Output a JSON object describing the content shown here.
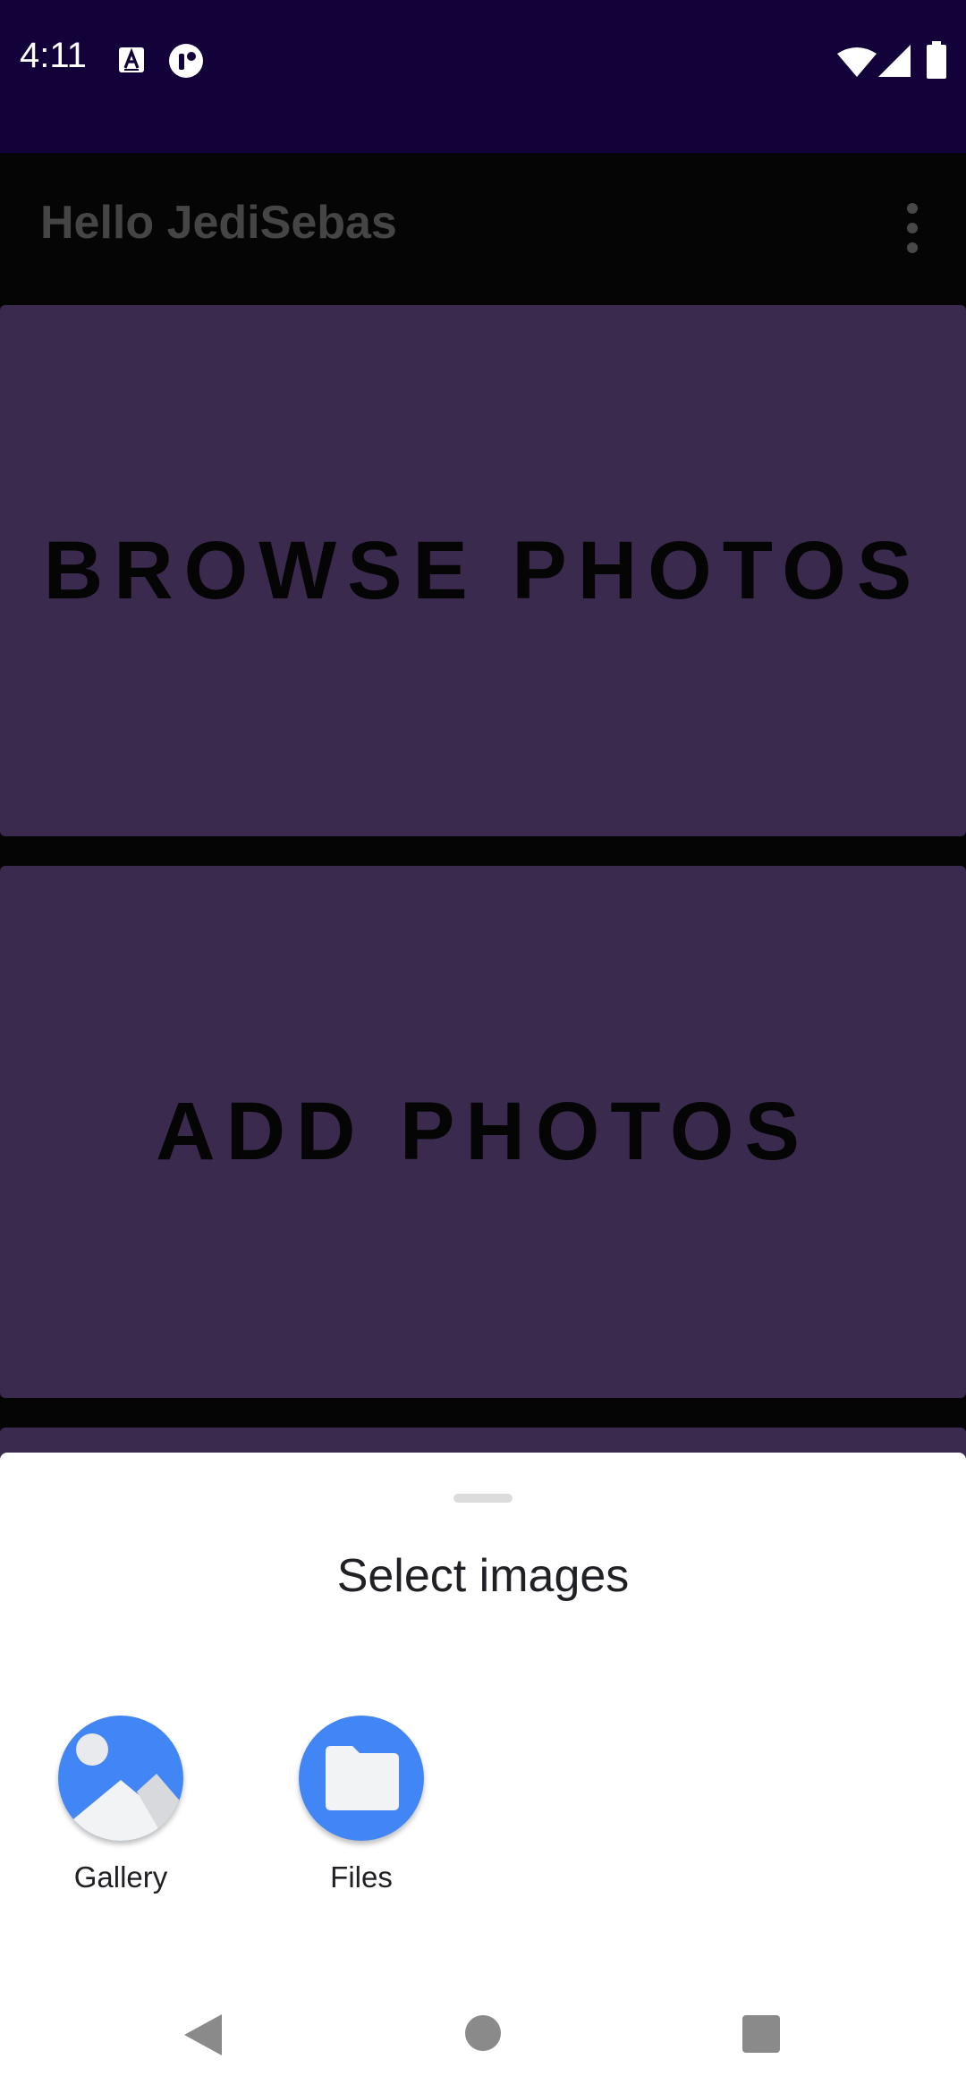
{
  "status_bar": {
    "time": "4:11",
    "icons": [
      "a-notification-icon",
      "record-icon",
      "wifi-icon",
      "signal-icon",
      "battery-icon"
    ]
  },
  "app_bar": {
    "title": "Hello JediSebas",
    "menu_icon": "more-vert-icon"
  },
  "main": {
    "browse_label": "BROWSE PHOTOS",
    "add_label": "ADD PHOTOS"
  },
  "sheet": {
    "title": "Select images",
    "apps": [
      {
        "label": "Gallery",
        "icon": "gallery-icon"
      },
      {
        "label": "Files",
        "icon": "folder-icon"
      }
    ]
  },
  "nav_bar": {
    "icons": [
      "back-icon",
      "home-icon",
      "recents-icon"
    ]
  },
  "colors": {
    "status_bar": "#13023a",
    "card": "#3a2a4e",
    "accent": "#4285f4",
    "background": "#050505"
  }
}
